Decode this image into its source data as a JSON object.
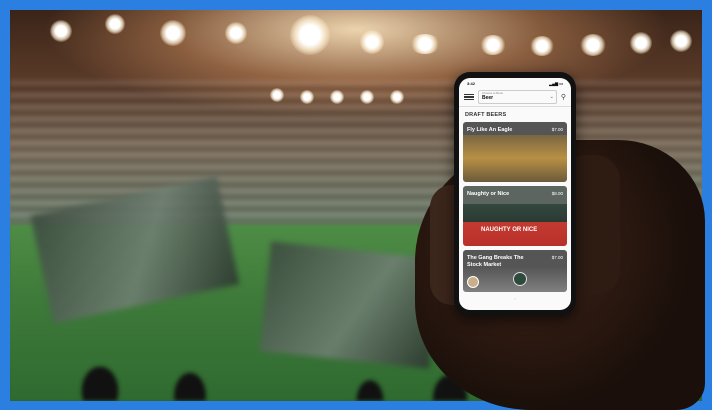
{
  "phone": {
    "status": {
      "time": "3:42"
    },
    "appbar": {
      "selector_caption": "Choose a Menu",
      "selector_value": "Beer"
    },
    "section_title": "DRAFT BEERS",
    "items": [
      {
        "name": "Fly Like An Eagle",
        "price": "$7.00"
      },
      {
        "name": "Naughty or Nice",
        "price": "$8.00",
        "banner": "NAUGHTY OR NICE"
      },
      {
        "name": "The Gang Breaks The Stock Market",
        "price": "$7.00"
      }
    ]
  }
}
